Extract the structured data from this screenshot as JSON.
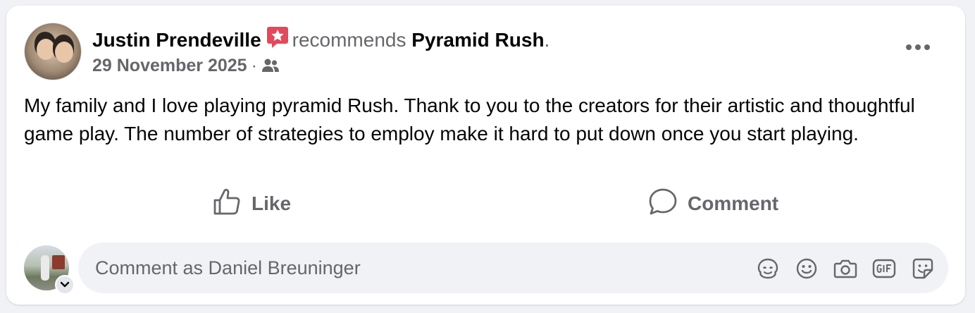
{
  "post": {
    "author_name": "Justin Prendeville",
    "action_text": "recommends",
    "page_name": "Pyramid Rush",
    "trailing_period": ".",
    "date": "29 November 2025",
    "separator": "·",
    "audience_icon": "friends-icon",
    "body": "My family and I love playing pyramid Rush. Thank to you to the creators for their artistic and thoughtful game play. The number of strategies to employ make it hard to put down once you start playing.",
    "recommend_badge_icon": "recommend-star-icon",
    "more_icon": "more-options-icon"
  },
  "actions": {
    "like_label": "Like",
    "comment_label": "Comment"
  },
  "composer": {
    "placeholder": "Comment as Daniel Breuninger",
    "tools": [
      "avatar-sticker-icon",
      "emoji-icon",
      "camera-icon",
      "gif-icon",
      "sticker-icon"
    ]
  },
  "colors": {
    "badge": "#e4485b",
    "secondary_text": "#65676b",
    "primary_text": "#050505",
    "composer_bg": "#f0f2f5"
  }
}
